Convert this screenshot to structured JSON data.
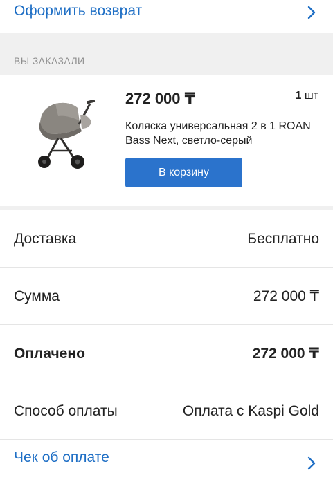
{
  "top_link": {
    "label": "Оформить возврат",
    "icon": "chevron-right-icon"
  },
  "section": {
    "header": "ВЫ ЗАКАЗАЛИ"
  },
  "product": {
    "image_icon": "stroller-image",
    "price": "272 000 ₸",
    "quantity_number": "1",
    "quantity_unit": "шт",
    "title": "Коляска универсальная 2 в 1 ROAN Bass Next, светло-серый",
    "cart_button": "В корзину"
  },
  "summary": [
    {
      "key": "Доставка",
      "value": "Бесплатно"
    },
    {
      "key": "Сумма",
      "value": "272 000 ₸"
    },
    {
      "key": "Оплачено",
      "value": "272 000 ₸"
    },
    {
      "key": "Способ оплаты",
      "value": "Оплата с Kaspi Gold"
    }
  ],
  "receipt_link": {
    "label": "Чек об оплате",
    "icon": "chevron-right-icon"
  },
  "colors": {
    "link": "#1f6fc5",
    "button": "#2b73cc",
    "section_bg": "#f0f0f0",
    "muted_text": "#8e8e8e"
  }
}
